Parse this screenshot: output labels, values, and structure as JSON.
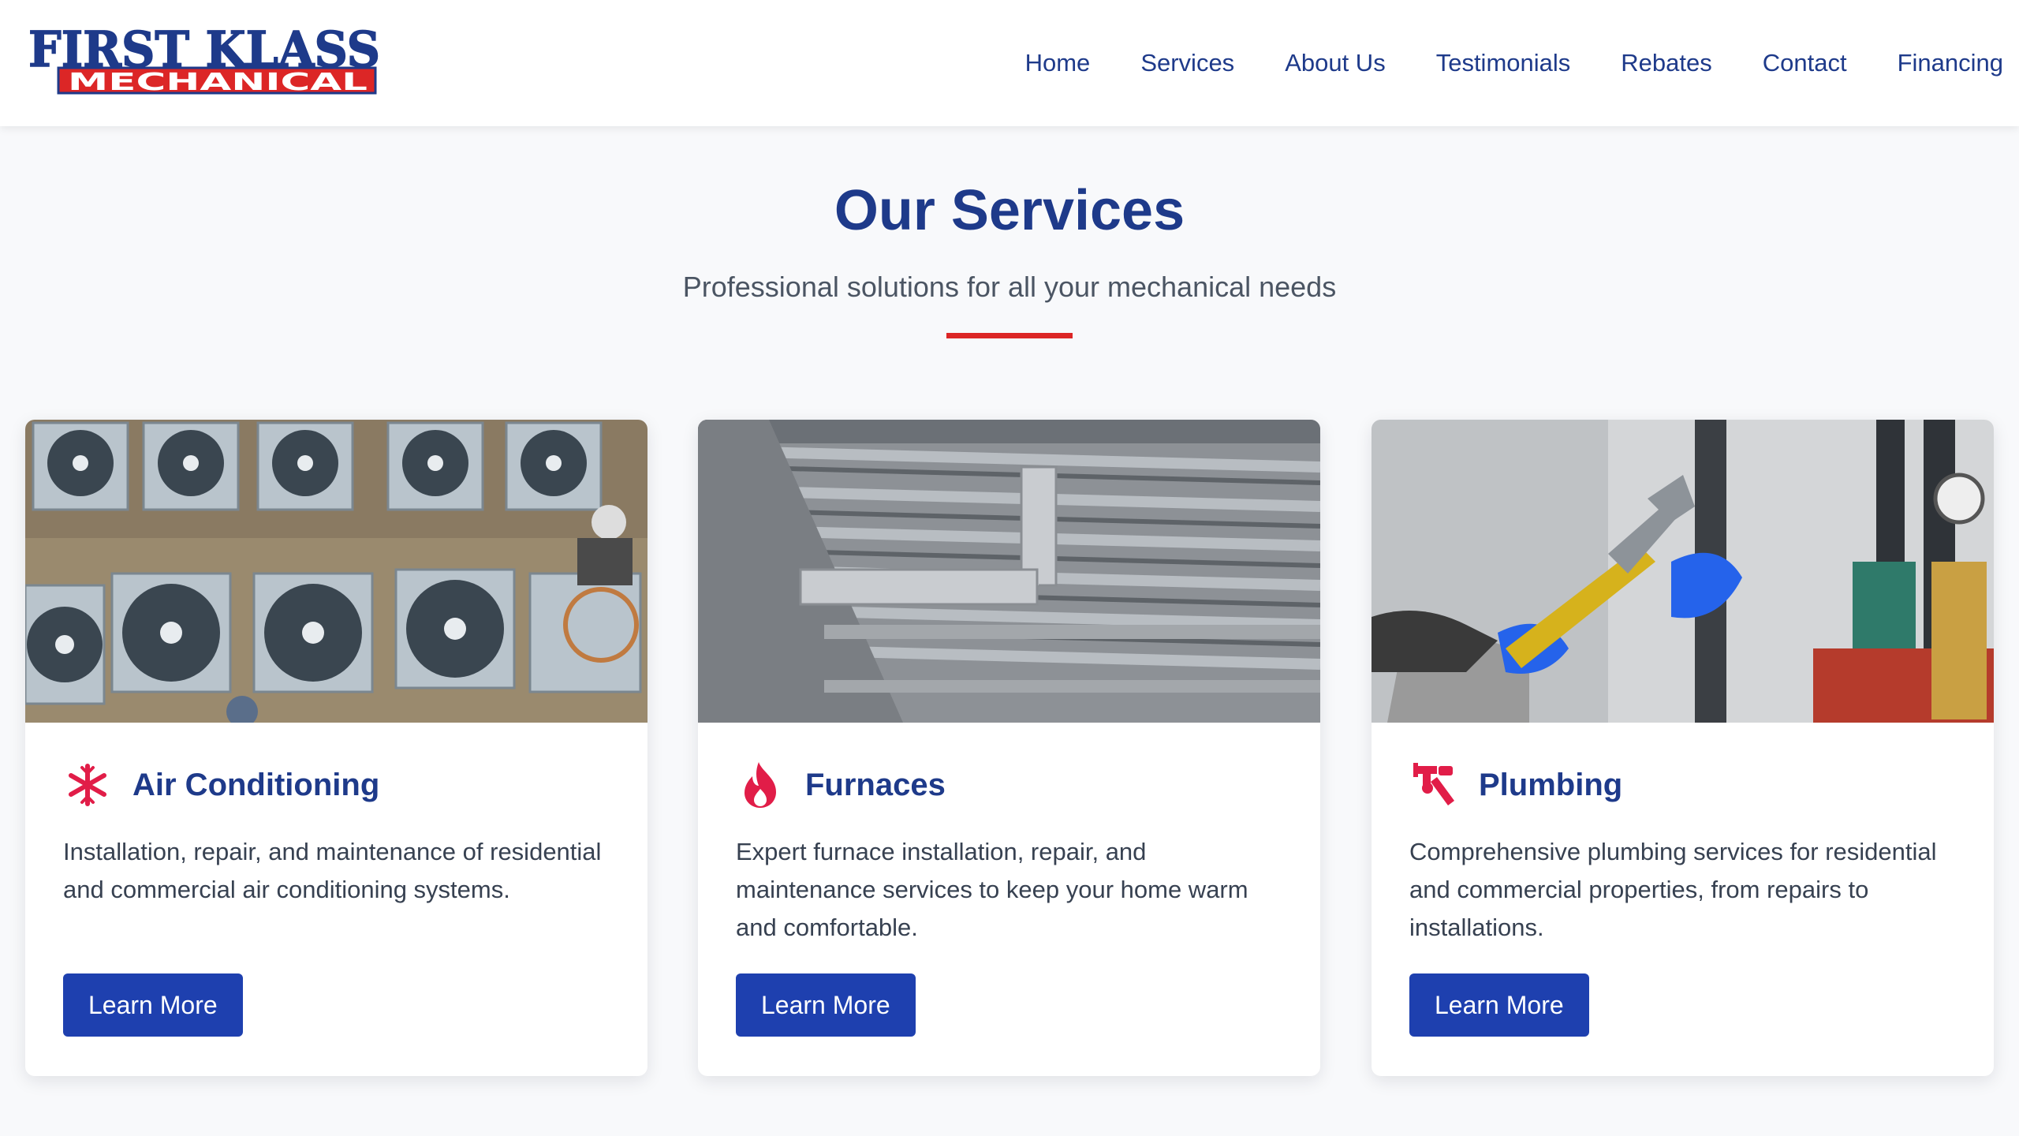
{
  "brand": {
    "logo_line1": "FIRST KLASS",
    "logo_line2": "MECHANICAL",
    "primary_color": "#1e3a8a",
    "accent_color": "#dc2626"
  },
  "nav": {
    "items": [
      {
        "label": "Home"
      },
      {
        "label": "Services"
      },
      {
        "label": "About Us"
      },
      {
        "label": "Testimonials"
      },
      {
        "label": "Rebates"
      },
      {
        "label": "Contact"
      },
      {
        "label": "Financing"
      }
    ]
  },
  "section": {
    "title": "Our Services",
    "subtitle": "Professional solutions for all your mechanical needs"
  },
  "cards": [
    {
      "icon": "snowflake-icon",
      "title": "Air Conditioning",
      "description": "Installation, repair, and maintenance of residential and commercial air conditioning systems.",
      "button": "Learn More"
    },
    {
      "icon": "flame-icon",
      "title": "Furnaces",
      "description": "Expert furnace installation, repair, and maintenance services to keep your home warm and comfortable.",
      "button": "Learn More"
    },
    {
      "icon": "wrench-pipe-icon",
      "title": "Plumbing",
      "description": "Comprehensive plumbing services for residential and commercial properties, from repairs to installations.",
      "button": "Learn More"
    }
  ]
}
